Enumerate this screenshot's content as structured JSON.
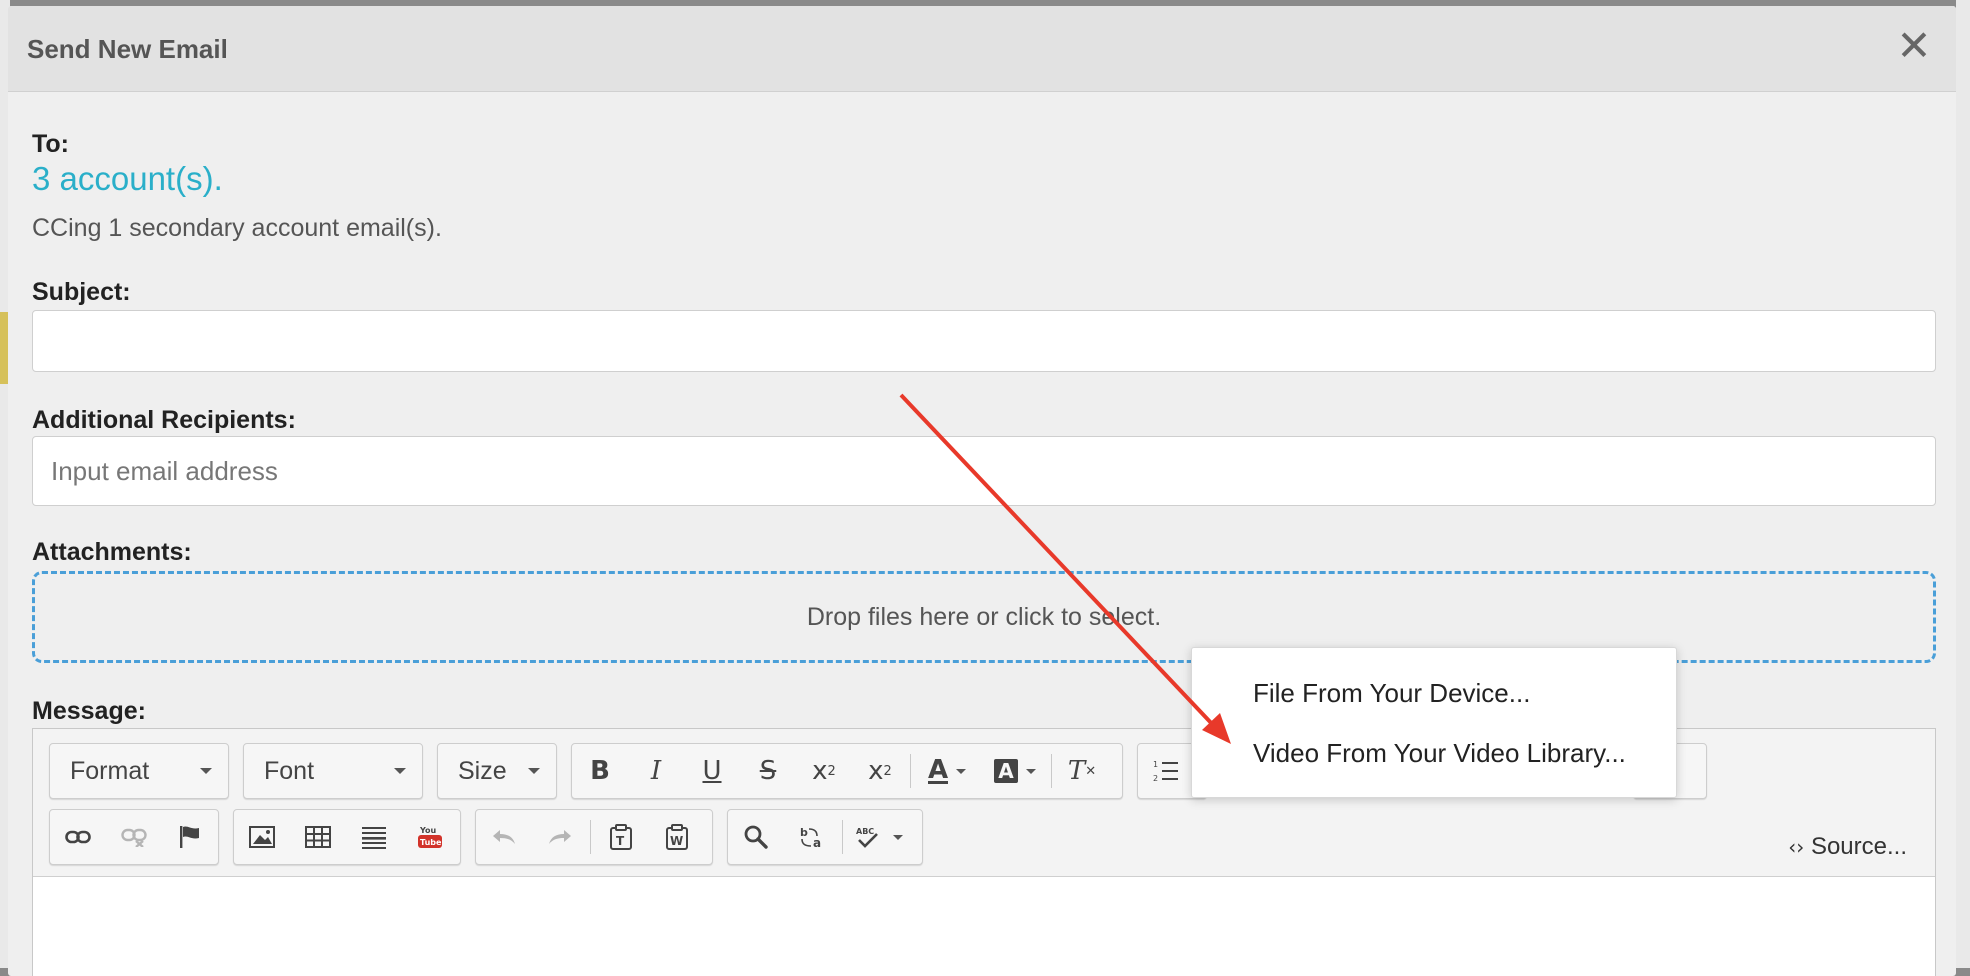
{
  "modal": {
    "title": "Send New Email",
    "close_icon": "close-icon"
  },
  "to": {
    "label": "To:",
    "accounts": "3 account(s).",
    "cc_note": "CCing 1 secondary account email(s)."
  },
  "subject": {
    "label": "Subject:",
    "value": ""
  },
  "recipients": {
    "label": "Additional Recipients:",
    "placeholder": "Input email address"
  },
  "attachments": {
    "label": "Attachments:",
    "dropzone_text": "Drop files here or click to select."
  },
  "message": {
    "label": "Message:",
    "toolbar": {
      "format_label": "Format",
      "font_label": "Font",
      "size_label": "Size",
      "source_label": "Source..."
    }
  },
  "attach_menu": {
    "items": [
      "File From Your Device...",
      "Video From Your Video Library..."
    ]
  },
  "colors": {
    "accent_link": "#2aafc9",
    "dropzone_border": "#4a9fd8",
    "annotation_arrow": "#e8392a"
  }
}
